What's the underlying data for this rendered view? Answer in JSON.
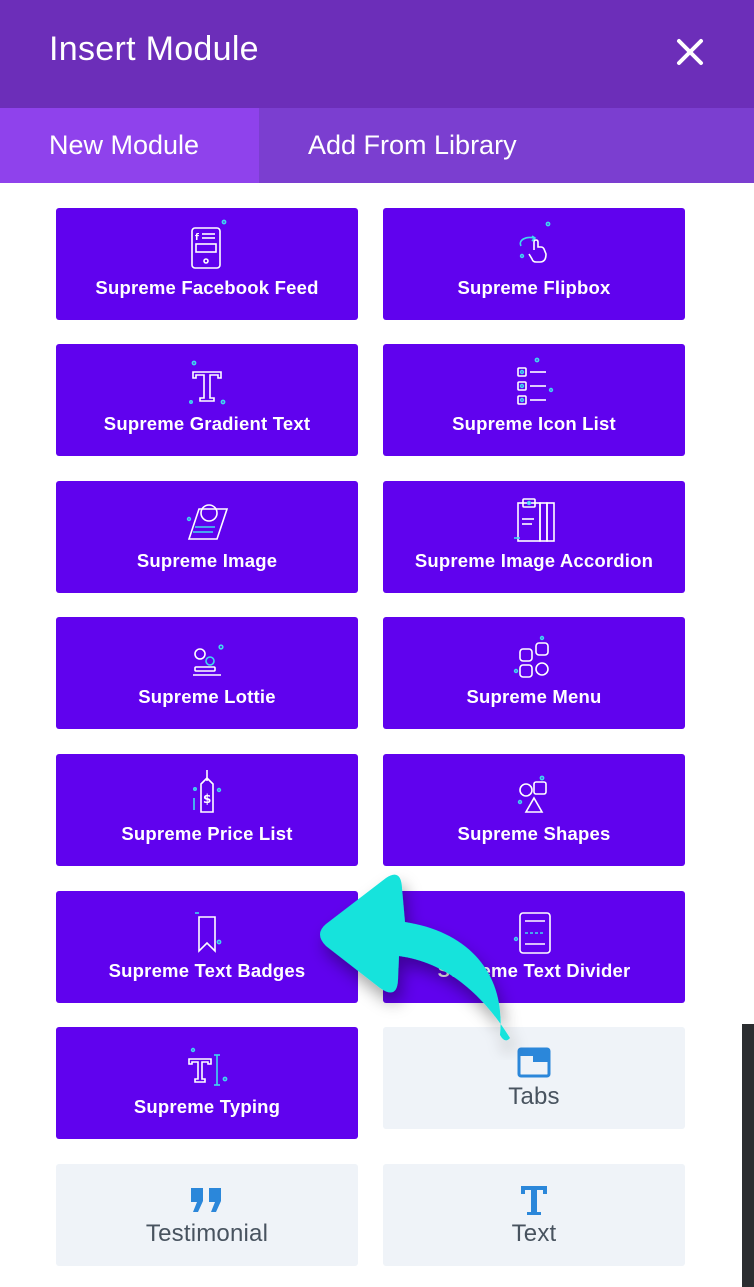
{
  "header": {
    "title": "Insert Module",
    "close_icon": "close-icon"
  },
  "tabs": [
    {
      "label": "New Module",
      "active": true
    },
    {
      "label": "Add From Library",
      "active": false
    }
  ],
  "modules": [
    {
      "label": "Supreme Facebook Feed",
      "icon": "facebook-feed-icon",
      "style": "supreme"
    },
    {
      "label": "Supreme Flipbox",
      "icon": "flipbox-icon",
      "style": "supreme"
    },
    {
      "label": "Supreme Gradient Text",
      "icon": "gradient-text-icon",
      "style": "supreme"
    },
    {
      "label": "Supreme Icon List",
      "icon": "icon-list-icon",
      "style": "supreme"
    },
    {
      "label": "Supreme Image",
      "icon": "image-icon",
      "style": "supreme"
    },
    {
      "label": "Supreme Image Accordion",
      "icon": "image-accordion-icon",
      "style": "supreme"
    },
    {
      "label": "Supreme Lottie",
      "icon": "lottie-icon",
      "style": "supreme"
    },
    {
      "label": "Supreme Menu",
      "icon": "menu-icon",
      "style": "supreme"
    },
    {
      "label": "Supreme Price List",
      "icon": "price-list-icon",
      "style": "supreme"
    },
    {
      "label": "Supreme Shapes",
      "icon": "shapes-icon",
      "style": "supreme"
    },
    {
      "label": "Supreme Text Badges",
      "icon": "text-badges-icon",
      "style": "supreme"
    },
    {
      "label": "Supreme Text Divider",
      "icon": "text-divider-icon",
      "style": "supreme"
    },
    {
      "label": "Supreme Typing",
      "icon": "typing-icon",
      "style": "supreme"
    },
    {
      "label": "Tabs",
      "icon": "tabs-icon",
      "style": "default"
    },
    {
      "label": "Testimonial",
      "icon": "quote-icon",
      "style": "default"
    },
    {
      "label": "Text",
      "icon": "text-icon",
      "style": "default"
    }
  ],
  "colors": {
    "header_bg": "#6c2eb9",
    "tabs_bg": "#7b3ed0",
    "active_tab_bg": "#8f42ec",
    "supreme_module_bg": "#6002ee",
    "supreme_icon_accent": "#3fd9ee",
    "default_module_bg": "#eff3f8",
    "default_icon_color": "#2b87da",
    "default_label_color": "#48535f",
    "annotation_arrow": "#12e3dc"
  },
  "annotation": {
    "icon": "curved-arrow-icon",
    "points_to": "Supreme Text Badges"
  }
}
